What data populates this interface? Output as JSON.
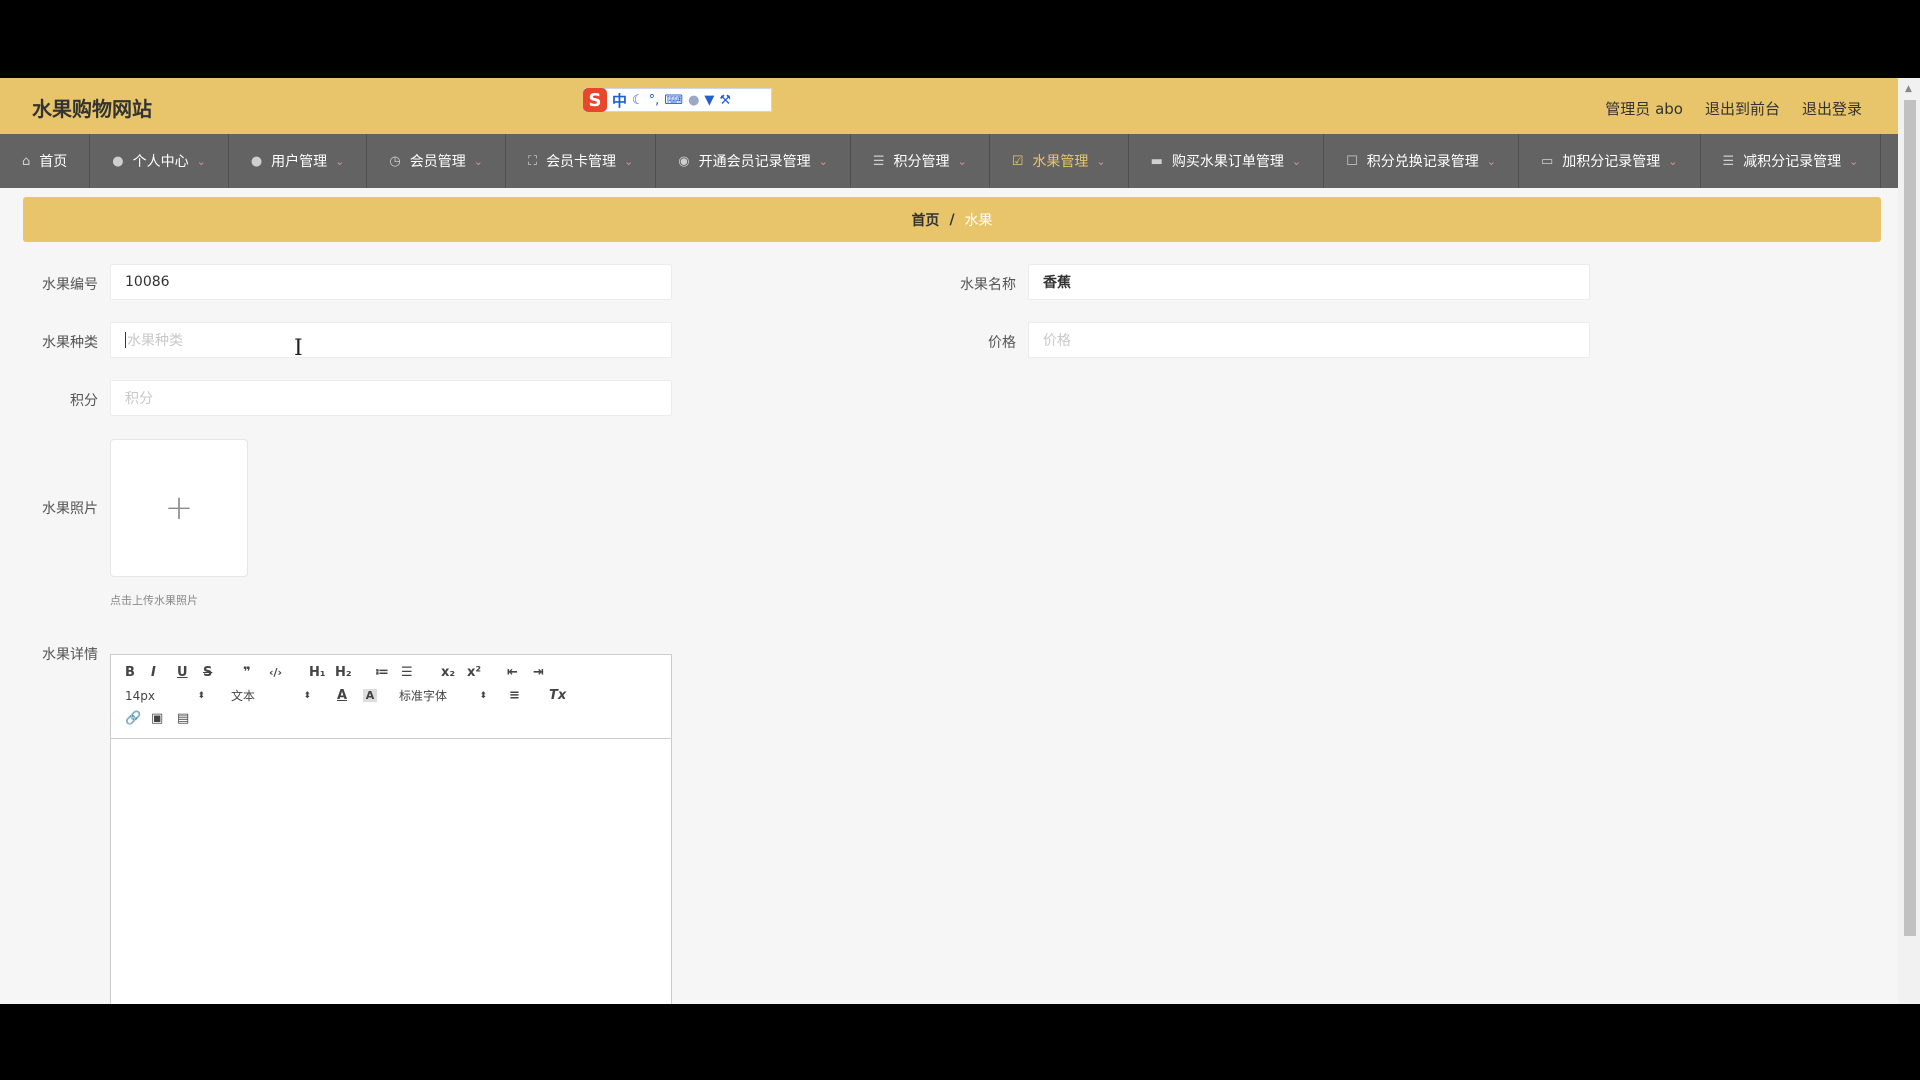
{
  "site_title": "水果购物网站",
  "ime": {
    "logo": "S",
    "mode": "中",
    "icons": [
      "moon-icon",
      "punctuation-icon",
      "keyboard-icon",
      "user-icon",
      "shirt-icon",
      "wrench-icon"
    ]
  },
  "top_links": {
    "admin": "管理员 abo",
    "to_front": "退出到前台",
    "logout": "退出登录"
  },
  "nav": [
    {
      "label": "首页",
      "icon": "home-icon",
      "has_arrow": false
    },
    {
      "label": "个人中心",
      "icon": "user-icon",
      "has_arrow": true
    },
    {
      "label": "用户管理",
      "icon": "user-icon",
      "has_arrow": true
    },
    {
      "label": "会员管理",
      "icon": "clock-icon",
      "has_arrow": true
    },
    {
      "label": "会员卡管理",
      "icon": "expand-icon",
      "has_arrow": true
    },
    {
      "label": "开通会员记录管理",
      "icon": "compass-icon",
      "has_arrow": true
    },
    {
      "label": "积分管理",
      "icon": "menu-icon",
      "has_arrow": true
    },
    {
      "label": "水果管理",
      "icon": "checkbox-icon",
      "has_arrow": true,
      "active": true
    },
    {
      "label": "购买水果订单管理",
      "icon": "briefcase-icon",
      "has_arrow": true
    },
    {
      "label": "积分兑换记录管理",
      "icon": "chart-icon",
      "has_arrow": true
    },
    {
      "label": "加积分记录管理",
      "icon": "message-icon",
      "has_arrow": true
    },
    {
      "label": "减积分记录管理",
      "icon": "menu-icon",
      "has_arrow": true
    }
  ],
  "breadcrumb": {
    "home": "首页",
    "separator": "/",
    "current": "水果"
  },
  "form": {
    "fruit_id": {
      "label": "水果编号",
      "value": "10086"
    },
    "fruit_name": {
      "label": "水果名称",
      "value": "香蕉"
    },
    "fruit_type": {
      "label": "水果种类",
      "placeholder": "水果种类"
    },
    "price": {
      "label": "价格",
      "placeholder": "价格"
    },
    "points": {
      "label": "积分",
      "placeholder": "积分"
    },
    "photo": {
      "label": "水果照片",
      "hint": "点击上传水果照片"
    },
    "details": {
      "label": "水果详情"
    }
  },
  "editor": {
    "row1": [
      "B",
      "I",
      "U",
      "S",
      "❞",
      "‹/›",
      "H₁",
      "H₂",
      "≔",
      "☰",
      "x₂",
      "x²",
      "⇤",
      "⇥"
    ],
    "font_size": "14px",
    "header": "文本",
    "font_family": "标准字体",
    "color_btn": "A",
    "bg_btn": "A",
    "align_btn": "≡",
    "clear_btn": "Tx",
    "row3": [
      "link-icon",
      "image-icon",
      "video-icon"
    ]
  },
  "colors": {
    "accent": "#e8c56a",
    "nav_bg": "#636363",
    "nav_active": "#e8c56a"
  }
}
